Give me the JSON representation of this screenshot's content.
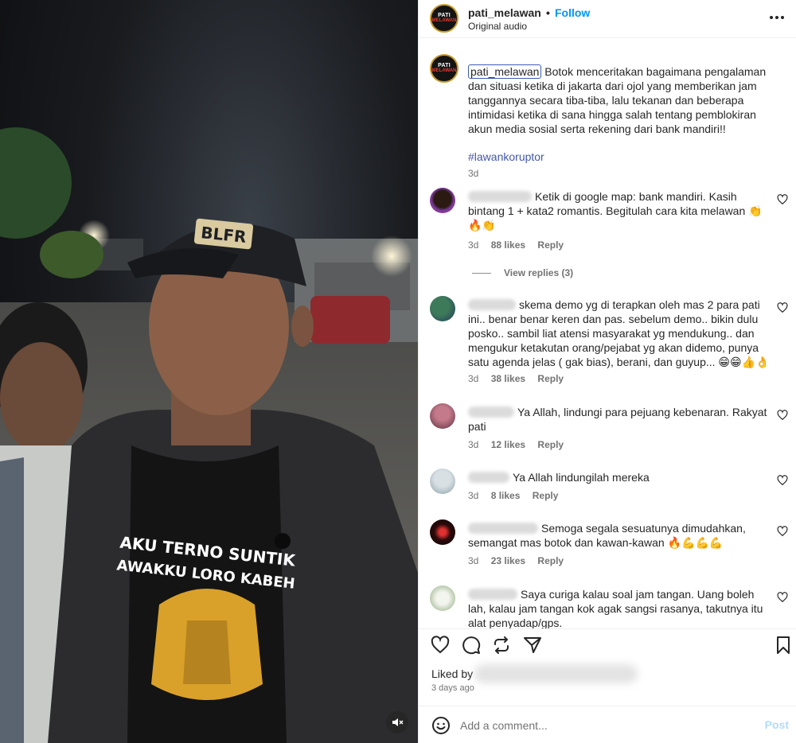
{
  "post": {
    "username": "pati_melawan",
    "dot": "•",
    "follow_label": "Follow",
    "audio": "Original audio",
    "logo_line1": "PATI",
    "logo_line2": "MELAWAN",
    "shirt_text_1": "AKU TERNO SUNTIK",
    "shirt_text_2": "AWAKKU LORO KABEH",
    "cap_text": "BLFR"
  },
  "caption": {
    "username": "pati_melawan",
    "text": "Botok menceritakan bagaimana pengalaman dan situasi ketika di jakarta dari ojol yang memberikan jam tanggannya secara tiba-tiba, lalu tekanan dan beberapa intimidasi ketika di sana hingga salah tentang pemblokiran akun media sosial serta rekening dari bank mandiri!!",
    "hashtag": "#lawankoruptor",
    "time": "3d"
  },
  "comments": [
    {
      "text": "Ketik di google map: bank mandiri. Kasih bintang 1 + kata2 romantis. Begitulah cara kita melawan 👏🔥👏",
      "time": "3d",
      "likes": "88 likes",
      "reply": "Reply"
    },
    {
      "text": "skema demo yg di terapkan oleh mas 2 para pati ini.. benar benar keren dan pas. sebelum demo.. bikin dulu posko.. sambil liat atensi masyarakat yg mendukung.. dan mengukur ketakutan orang/pejabat yg akan didemo, punya satu agenda jelas ( gak bias), berani, dan guyup... 😁😁👍👌",
      "time": "3d",
      "likes": "38 likes",
      "reply": "Reply"
    },
    {
      "text": "Ya Allah, lindungi para pejuang kebenaran. Rakyat pati",
      "time": "3d",
      "likes": "12 likes",
      "reply": "Reply"
    },
    {
      "text": "Ya Allah lindungilah mereka",
      "time": "3d",
      "likes": "8 likes",
      "reply": "Reply"
    },
    {
      "text": "Semoga segala sesuatunya dimudahkan, semangat mas botok dan kawan-kawan 🔥💪💪💪",
      "time": "3d",
      "likes": "23 likes",
      "reply": "Reply"
    },
    {
      "text": "Saya curiga kalau soal jam tangan. Uang boleh lah, kalau jam tangan kok agak sangsi rasanya, takutnya itu alat penyadap/gps.",
      "time": "",
      "likes": "",
      "reply": ""
    }
  ],
  "view_replies": "View replies (3)",
  "footer": {
    "liked_by": "Liked by",
    "ago": "3 days ago",
    "add_placeholder": "Add a comment...",
    "post_label": "Post"
  },
  "colors": {
    "link": "#0095f6",
    "hashtag": "#4257b2",
    "muted": "#737373",
    "post_disabled": "#b3dbff"
  },
  "icons": [
    "more-icon",
    "heart-icon",
    "comment-icon",
    "share-icon",
    "send-icon",
    "bookmark-icon",
    "emoji-icon",
    "mute-icon"
  ]
}
